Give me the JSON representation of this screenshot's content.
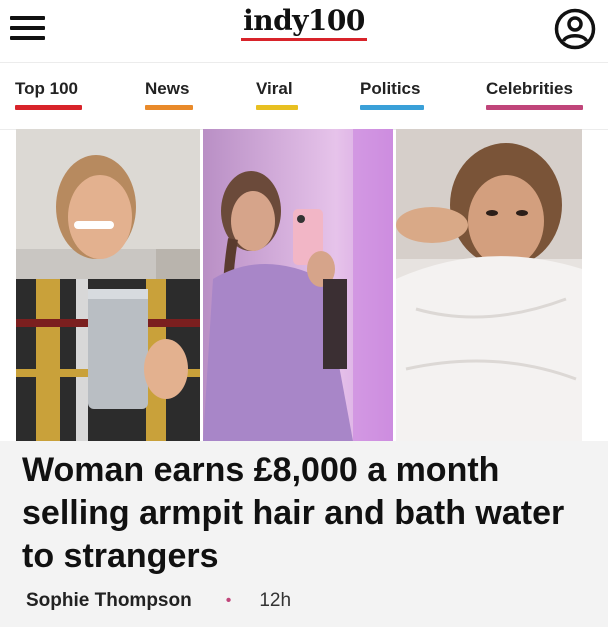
{
  "header": {
    "logo": "indy100",
    "accent": "#d8232a"
  },
  "nav": {
    "tabs": [
      {
        "label": "Top 100",
        "color": "#d8232a"
      },
      {
        "label": "News",
        "color": "#e98a2a"
      },
      {
        "label": "Viral",
        "color": "#e8c021"
      },
      {
        "label": "Politics",
        "color": "#3aa0d8"
      },
      {
        "label": "Celebrities",
        "color": "#c0457a"
      }
    ]
  },
  "article": {
    "headline": "Woman earns £8,000 a month selling armpit hair and bath water to strangers",
    "author": "Sophie Thompson",
    "separator": "•",
    "time": "12h"
  },
  "icons": {
    "menu": "hamburger-menu-icon",
    "account": "user-account-icon"
  }
}
